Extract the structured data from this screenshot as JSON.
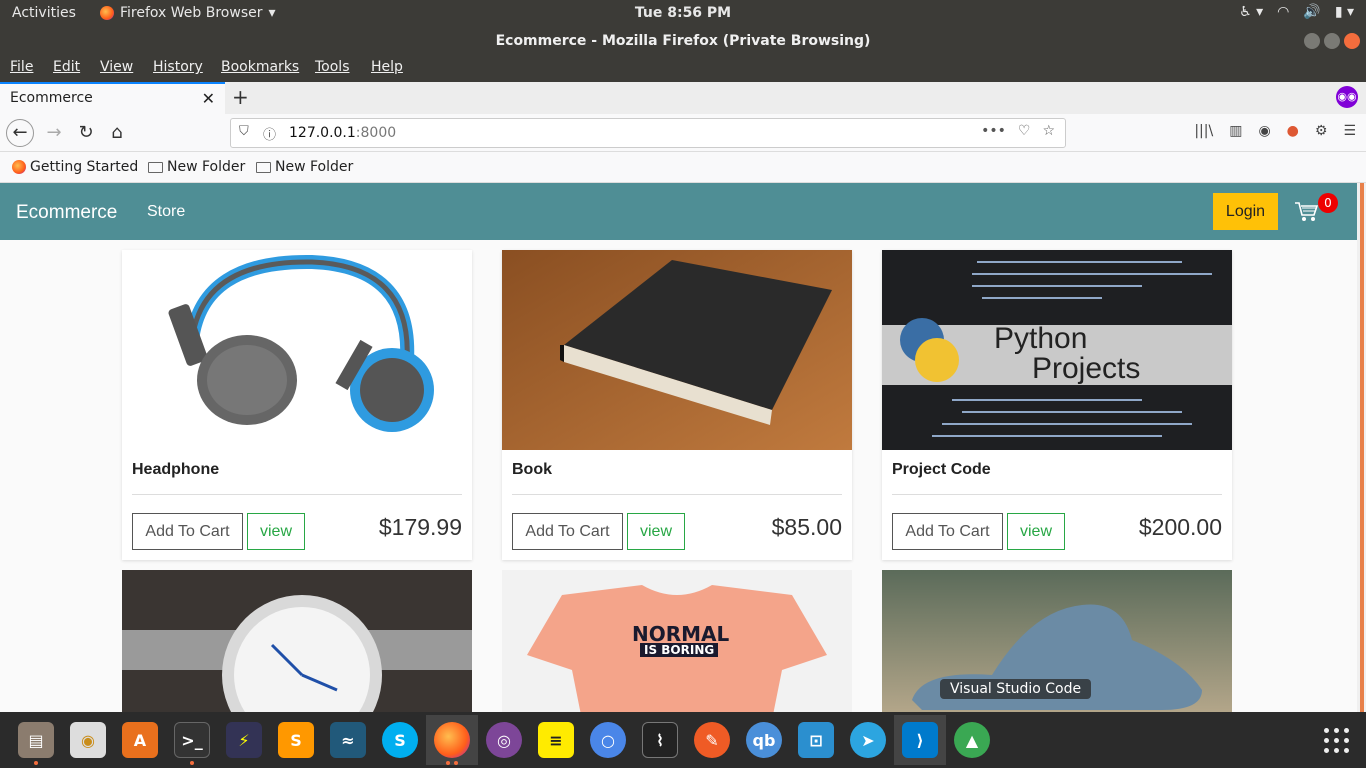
{
  "topbar": {
    "activities": "Activities",
    "app": "Firefox Web Browser",
    "clock": "Tue  8:56 PM"
  },
  "window": {
    "title": "Ecommerce - Mozilla Firefox (Private Browsing)"
  },
  "menu": [
    "File",
    "Edit",
    "View",
    "History",
    "Bookmarks",
    "Tools",
    "Help"
  ],
  "tab": {
    "title": "Ecommerce"
  },
  "url": {
    "host": "127.0.0.1",
    "port": ":8000"
  },
  "bookmarks": [
    "Getting Started",
    "New Folder",
    "New Folder"
  ],
  "site": {
    "brand": "Ecommerce",
    "store": "Store",
    "login": "Login",
    "cart_count": "0",
    "add_label": "Add To Cart",
    "view_label": "view"
  },
  "products": [
    {
      "name": "Headphone",
      "price": "$179.99"
    },
    {
      "name": "Book",
      "price": "$85.00"
    },
    {
      "name": "Project Code",
      "price": "$200.00"
    }
  ],
  "python_logo_text": [
    "Python",
    "Projects"
  ],
  "shirt_text": [
    "NORMAL",
    "IS BORING"
  ],
  "tooltip": "Visual Studio Code",
  "colors": {
    "navbar": "#4f8e95",
    "login": "#ffc107",
    "view": "#28a745",
    "badge": "#ee0000"
  }
}
